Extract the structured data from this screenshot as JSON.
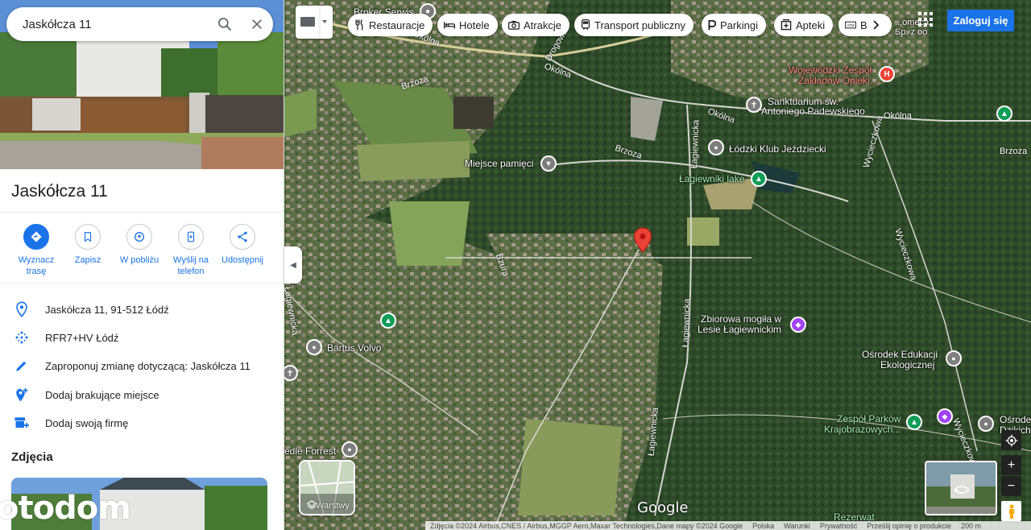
{
  "search": {
    "query": "Jaskółcza 11"
  },
  "place": {
    "title": "Jaskółcza 11"
  },
  "actions": [
    {
      "label_1": "Wyznacz",
      "label_2": "trasę",
      "icon": "directions-icon"
    },
    {
      "label_1": "Zapisz",
      "label_2": "",
      "icon": "bookmark-icon"
    },
    {
      "label_1": "W pobliżu",
      "label_2": "",
      "icon": "nearby-icon"
    },
    {
      "label_1": "Wyślij na",
      "label_2": "telefon",
      "icon": "send-to-phone-icon"
    },
    {
      "label_1": "Udostępnij",
      "label_2": "",
      "icon": "share-icon"
    }
  ],
  "info": [
    {
      "text": "Jaskółcza 11, 91-512 Łódź",
      "icon": "location-pin-icon"
    },
    {
      "text": "RFR7+HV Łódź",
      "icon": "plus-code-icon"
    },
    {
      "text": "Zaproponuj zmianę dotyczącą: Jaskółcza 11",
      "icon": "edit-pencil-icon"
    },
    {
      "text": "Dodaj brakujące miejsce",
      "icon": "add-place-icon"
    },
    {
      "text": "Dodaj swoją firmę",
      "icon": "add-business-icon"
    }
  ],
  "photos": {
    "heading": "Zdjęcia"
  },
  "watermark": "otodom",
  "chips": [
    {
      "label": "Restauracje",
      "icon": "restaurant-icon"
    },
    {
      "label": "Hotele",
      "icon": "hotel-icon"
    },
    {
      "label": "Atrakcje",
      "icon": "camera-icon"
    },
    {
      "label": "Transport publiczny",
      "icon": "transit-icon"
    },
    {
      "label": "Parkingi",
      "icon": "parking-icon"
    },
    {
      "label": "Apteki",
      "icon": "pharmacy-icon"
    },
    {
      "label": "B",
      "icon": "atm-icon"
    }
  ],
  "header": {
    "login": "Zaloguj się"
  },
  "map_labels": {
    "poi": [
      "Broker Serwis",
      "Miejsce pamięci",
      "Wojewódzki Zespół",
      "Zakładów Opieki...",
      "Sanktuarium św.",
      "Antoniego Padewskiego",
      "Łódzki Klub Jeździecki",
      "Łagiewniki lake",
      "Zbiorowa mogiła w",
      "Lesie Łagiewnickim",
      "Bartus Volvo",
      "Ośrodek Edukacji",
      "Ekologicznej",
      "Zespół Parków",
      "Krajobrazowych...",
      "edle Forrest",
      "Ośrodek",
      "Dzikich",
      "Rezerwat",
      "...omeca",
      "Sp. z oo"
    ],
    "roads": [
      "Okólna",
      "Okólna",
      "Okólna",
      "Brzoza",
      "Brzoza",
      "Drogowa",
      "Okólna",
      "Łagiewnicka",
      "Łagiewnicka",
      "Łagiewnicka",
      "Łagiewnicka",
      "Bzura",
      "Wycieczkowa",
      "Wycieczkowa",
      "Wycieczkowa",
      "Brzoza"
    ]
  },
  "map_controls": {
    "layers": "Warstwy",
    "google": "Google"
  },
  "footer": {
    "attribution": "Zdjęcia ©2024 Airbus,CNES / Airbus,MGGP Aero,Maxar Technologies,Dane mapy ©2024 Google",
    "country": "Polska",
    "terms": "Warunki",
    "privacy": "Prywatność",
    "feedback": "Prześlij opinię o produkcie",
    "scale": "200 m"
  },
  "colors": {
    "accent": "#1a73e8",
    "pin": "#ea4335",
    "green_pin": "#0f9d58",
    "purple_pin": "#a142f4"
  }
}
